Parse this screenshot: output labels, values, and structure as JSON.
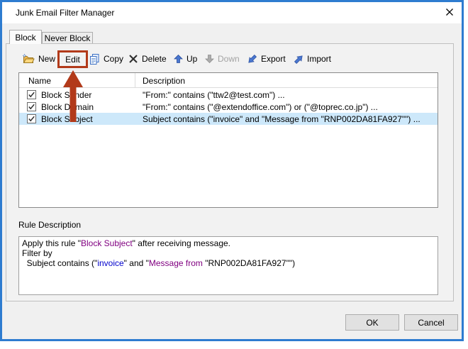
{
  "window": {
    "title": "Junk Email Filter Manager"
  },
  "tabs": {
    "block": "Block",
    "never_block": "Never Block"
  },
  "toolbar": {
    "new_label": "New",
    "edit_label": "Edit",
    "copy_label": "Copy",
    "delete_label": "Delete",
    "up_label": "Up",
    "down_label": "Down",
    "export_label": "Export",
    "import_label": "Import"
  },
  "list": {
    "columns": {
      "name": "Name",
      "description": "Description"
    },
    "rows": [
      {
        "name": "Block Sender",
        "checked": true,
        "selected": false,
        "description": "\"From:\" contains (\"ttw2@test.com\") ..."
      },
      {
        "name": "Block Domain",
        "checked": true,
        "selected": false,
        "description": "\"From:\" contains (\"@extendoffice.com\") or (\"@toprec.co.jp\") ..."
      },
      {
        "name": "Block Subject",
        "checked": true,
        "selected": true,
        "description": "Subject contains (\"invoice\" and \"Message from \"RNP002DA81FA927\"\") ..."
      }
    ]
  },
  "rule_description": {
    "label": "Rule Description",
    "line1": {
      "a": "Apply this rule \"",
      "b": "Block Subject",
      "c": "\" after receiving message."
    },
    "line2": "Filter by",
    "line3": {
      "a": "  Subject contains (\"",
      "b": "invoice",
      "c": "\" and \"",
      "d": "Message from ",
      "e": "\"RNP002DA81FA927\"\")"
    }
  },
  "buttons": {
    "ok": "OK",
    "cancel": "Cancel"
  },
  "icons": {
    "new": "new-folder-icon",
    "copy": "copy-icon",
    "delete": "delete-x-icon",
    "up": "up-arrow-icon",
    "down": "down-arrow-icon",
    "export": "export-arrow-icon",
    "import": "import-arrow-icon",
    "close": "close-x-icon",
    "checkbox": "checked-checkbox-icon",
    "annotation": "red-arrow-annotation"
  },
  "colors": {
    "purple": "#800080",
    "blue": "#0000cc",
    "annotation": "#b23a1a",
    "selection": "#cde8fa",
    "window_border": "#2e7cd0"
  }
}
